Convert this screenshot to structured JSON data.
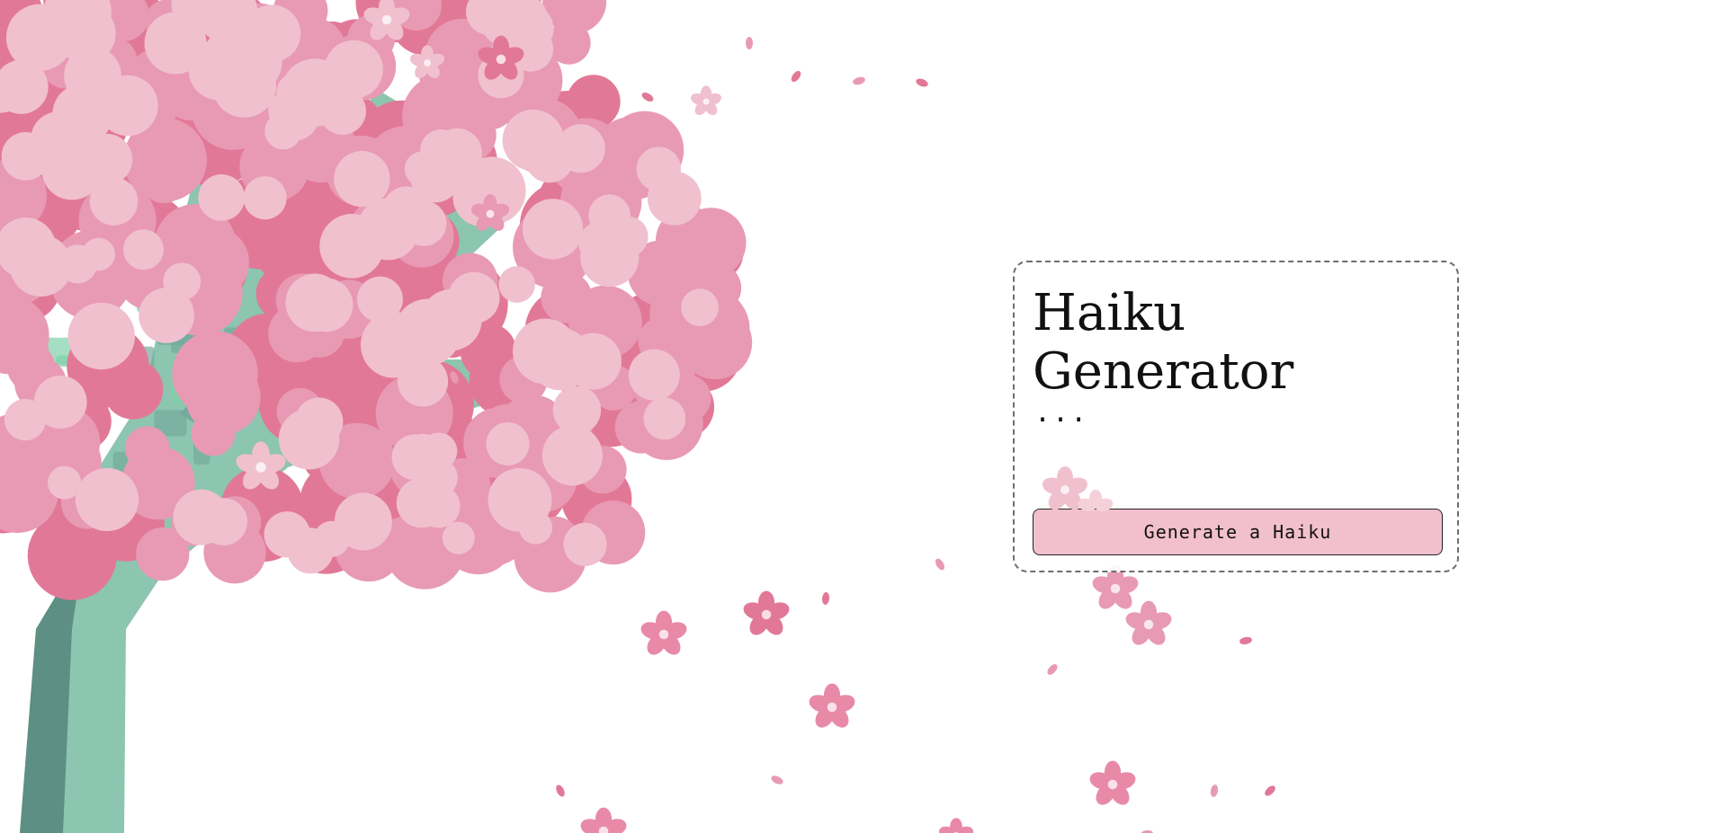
{
  "page": {
    "title": "Haiku Generator",
    "haiku_text": "...",
    "generate_button_label": "Generate a Haiku"
  },
  "illustration": {
    "subject": "cherry-blossom-tree",
    "colors": {
      "trunk_light": "#8cc5b0",
      "trunk_mid": "#74aa9b",
      "trunk_dark": "#5d8f84",
      "trunk_accent": "#7fd0aa",
      "blossom_dark": "#e27897",
      "blossom_mid": "#e89ab4",
      "blossom_light": "#f0c0cf",
      "petal": "#e889a8"
    }
  },
  "theme": {
    "button_bg": "#f2c0cd",
    "card_border": "#6e6e6e"
  }
}
